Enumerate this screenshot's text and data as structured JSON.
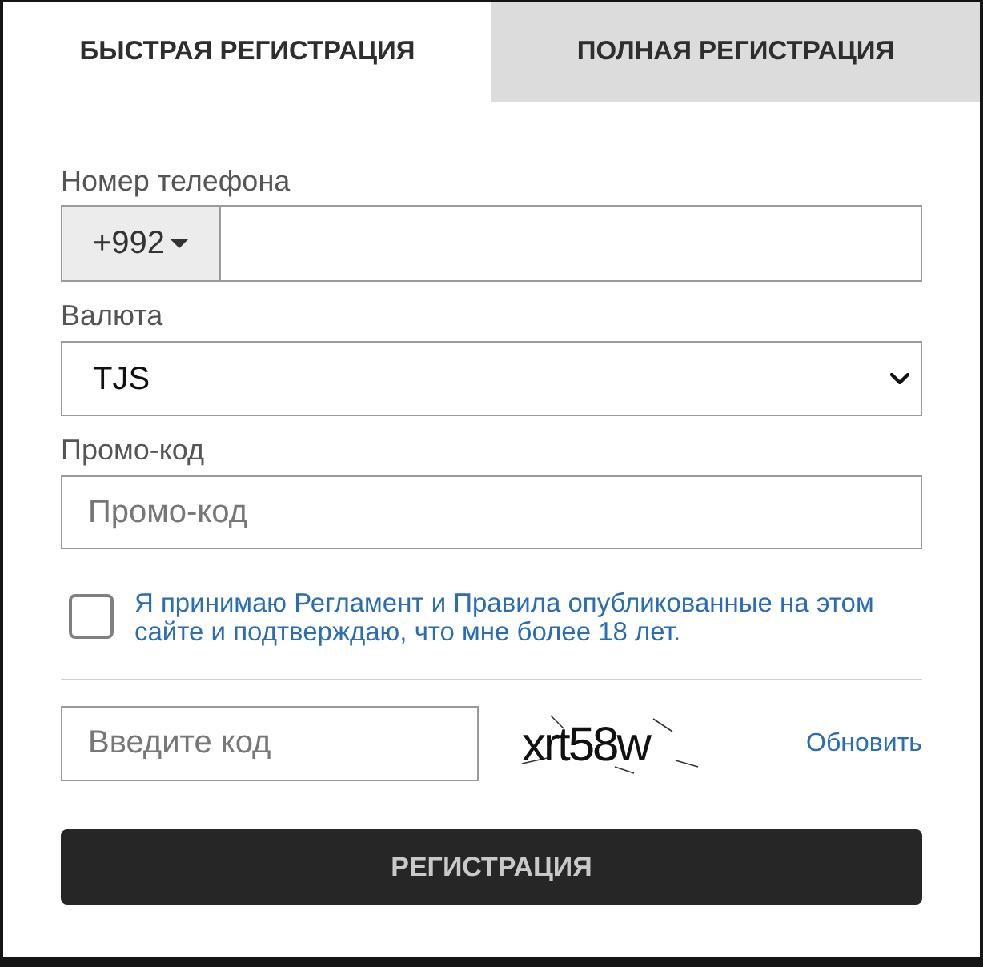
{
  "tabs": [
    {
      "label": "БЫСТРАЯ РЕГИСТРАЦИЯ",
      "selected": true
    },
    {
      "label": "ПОЛНАЯ РЕГИСТРАЦИЯ",
      "selected": false
    }
  ],
  "form": {
    "phone": {
      "label": "Номер телефона",
      "country_code": "+992"
    },
    "currency": {
      "label": "Валюта",
      "value": "TJS"
    },
    "promo": {
      "label": "Промо-код",
      "placeholder": "Промо-код"
    },
    "agreement": {
      "checked": false,
      "text": "Я принимаю Регламент и Правила опубликованные на этом сайте и подтверждаю, что мне более 18 лет."
    },
    "captcha": {
      "placeholder": "Введите код",
      "image_text": "xrt58w",
      "refresh_link": "Обновить"
    },
    "submit_button": "РЕГИСТРАЦИЯ"
  }
}
